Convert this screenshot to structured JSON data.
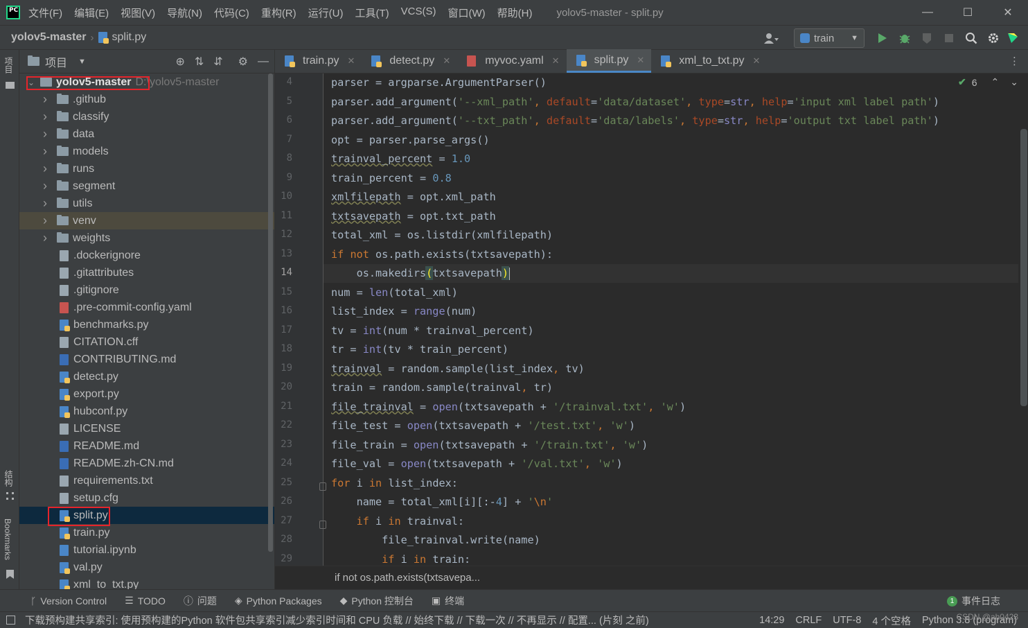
{
  "titlebar": {
    "menu": [
      "文件(F)",
      "编辑(E)",
      "视图(V)",
      "导航(N)",
      "代码(C)",
      "重构(R)",
      "运行(U)",
      "工具(T)",
      "VCS(S)",
      "窗口(W)",
      "帮助(H)"
    ],
    "window_title": "yolov5-master - split.py",
    "minimize": "—",
    "maximize": "☐",
    "close": "✕"
  },
  "navbar": {
    "project": "yolov5-master",
    "file": "split.py",
    "run_config": "train"
  },
  "left_strip": {
    "project_label": "项目",
    "structure_label": "结构",
    "bookmarks_label": "Bookmarks"
  },
  "project_panel": {
    "title": "项目",
    "root_name": "yolov5-master",
    "root_path": "D:\\yolov5-master",
    "items": [
      {
        "label": ".github",
        "kind": "folder"
      },
      {
        "label": "classify",
        "kind": "folder"
      },
      {
        "label": "data",
        "kind": "folder"
      },
      {
        "label": "models",
        "kind": "folder"
      },
      {
        "label": "runs",
        "kind": "folder"
      },
      {
        "label": "segment",
        "kind": "folder"
      },
      {
        "label": "utils",
        "kind": "folder"
      },
      {
        "label": "venv",
        "kind": "folder"
      },
      {
        "label": "weights",
        "kind": "folder"
      },
      {
        "label": ".dockerignore",
        "kind": "file"
      },
      {
        "label": ".gitattributes",
        "kind": "file"
      },
      {
        "label": ".gitignore",
        "kind": "file"
      },
      {
        "label": ".pre-commit-config.yaml",
        "kind": "yml"
      },
      {
        "label": "benchmarks.py",
        "kind": "py"
      },
      {
        "label": "CITATION.cff",
        "kind": "file"
      },
      {
        "label": "CONTRIBUTING.md",
        "kind": "md"
      },
      {
        "label": "detect.py",
        "kind": "py"
      },
      {
        "label": "export.py",
        "kind": "py"
      },
      {
        "label": "hubconf.py",
        "kind": "py"
      },
      {
        "label": "LICENSE",
        "kind": "file"
      },
      {
        "label": "README.md",
        "kind": "md"
      },
      {
        "label": "README.zh-CN.md",
        "kind": "md"
      },
      {
        "label": "requirements.txt",
        "kind": "file"
      },
      {
        "label": "setup.cfg",
        "kind": "file"
      },
      {
        "label": "split.py",
        "kind": "py"
      },
      {
        "label": "train.py",
        "kind": "py"
      },
      {
        "label": "tutorial.ipynb",
        "kind": "ipynb"
      },
      {
        "label": "val.py",
        "kind": "py"
      },
      {
        "label": "xml_to_txt.py",
        "kind": "py"
      }
    ]
  },
  "editor": {
    "tabs": [
      {
        "label": "train.py",
        "active": false
      },
      {
        "label": "detect.py",
        "active": false
      },
      {
        "label": "myvoc.yaml",
        "active": false
      },
      {
        "label": "split.py",
        "active": true
      },
      {
        "label": "xml_to_txt.py",
        "active": false
      }
    ],
    "inspection_count": "6",
    "current_line": 14,
    "breadcrumb": "if not os.path.exists(txtsavepa...",
    "lines": [
      {
        "n": "4",
        "code": "parser = argparse.ArgumentParser()"
      },
      {
        "n": "5",
        "code": "parser.add_argument('--xml_path', default='data/dataset', type=str, help='input xml label path')"
      },
      {
        "n": "6",
        "code": "parser.add_argument('--txt_path', default='data/labels', type=str, help='output txt label path')"
      },
      {
        "n": "7",
        "code": "opt = parser.parse_args()"
      },
      {
        "n": "8",
        "code": "trainval_percent = 1.0"
      },
      {
        "n": "9",
        "code": "train_percent = 0.8"
      },
      {
        "n": "10",
        "code": "xmlfilepath = opt.xml_path"
      },
      {
        "n": "11",
        "code": "txtsavepath = opt.txt_path"
      },
      {
        "n": "12",
        "code": "total_xml = os.listdir(xmlfilepath)"
      },
      {
        "n": "13",
        "code": "if not os.path.exists(txtsavepath):"
      },
      {
        "n": "14",
        "code": "    os.makedirs(txtsavepath)"
      },
      {
        "n": "15",
        "code": "num = len(total_xml)"
      },
      {
        "n": "16",
        "code": "list_index = range(num)"
      },
      {
        "n": "17",
        "code": "tv = int(num * trainval_percent)"
      },
      {
        "n": "18",
        "code": "tr = int(tv * train_percent)"
      },
      {
        "n": "19",
        "code": "trainval = random.sample(list_index, tv)"
      },
      {
        "n": "20",
        "code": "train = random.sample(trainval, tr)"
      },
      {
        "n": "21",
        "code": "file_trainval = open(txtsavepath + '/trainval.txt', 'w')"
      },
      {
        "n": "22",
        "code": "file_test = open(txtsavepath + '/test.txt', 'w')"
      },
      {
        "n": "23",
        "code": "file_train = open(txtsavepath + '/train.txt', 'w')"
      },
      {
        "n": "24",
        "code": "file_val = open(txtsavepath + '/val.txt', 'w')"
      },
      {
        "n": "25",
        "code": "for i in list_index:"
      },
      {
        "n": "26",
        "code": "    name = total_xml[i][:-4] + '\\n'"
      },
      {
        "n": "27",
        "code": "    if i in trainval:"
      },
      {
        "n": "28",
        "code": "        file_trainval.write(name)"
      },
      {
        "n": "29",
        "code": "        if i in train:"
      }
    ]
  },
  "bottom_tools": {
    "version_control": "Version Control",
    "todo": "TODO",
    "problems": "问题",
    "python_packages": "Python Packages",
    "python_console": "Python 控制台",
    "terminal": "终端",
    "event_log": "事件日志",
    "event_count": "1"
  },
  "statusbar": {
    "message": "下载预构建共享索引: 使用预构建的Python 软件包共享索引减少索引时间和 CPU 负载 // 始终下载 // 下载一次 // 不再显示 // 配置... (片刻 之前)",
    "position": "14:29",
    "line_sep": "CRLF",
    "encoding": "UTF-8",
    "indent": "4 个空格",
    "interpreter": "Python 3.8 (program)",
    "watermark": "CSDN @ah0423"
  },
  "colors": {
    "keyword": "#cc7832",
    "string": "#6a8759",
    "number": "#6897bb",
    "param": "#aa4926",
    "builtin": "#8888c6",
    "selection": "#0d293e",
    "highlight_box": "#e5242b",
    "run_green": "#59a869"
  },
  "icons": {
    "app": "pycharm-logo-icon",
    "run": "run-icon",
    "debug": "debug-icon",
    "coverage": "coverage-icon",
    "stop": "stop-icon",
    "search": "search-icon",
    "settings": "gear-icon",
    "user": "user-icon"
  }
}
